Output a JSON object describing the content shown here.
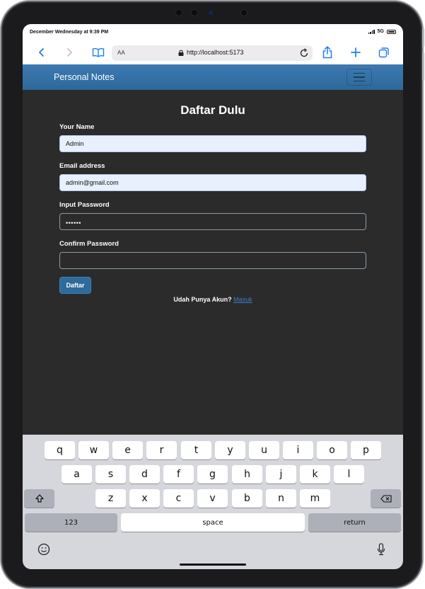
{
  "status": {
    "time": "December Wednesday at 9:39 PM",
    "network": "5G"
  },
  "browser": {
    "text_size_label": "AA",
    "url": "http://localhost:5173",
    "icons": [
      "chevron-left-icon",
      "chevron-right-icon",
      "book-icon",
      "lock-icon",
      "reload-icon",
      "share-icon",
      "plus-icon",
      "tabs-icon"
    ]
  },
  "navbar": {
    "brand": "Personal Notes"
  },
  "form": {
    "title": "Daftar Dulu",
    "name_label": "Your Name",
    "name_value": "Admin",
    "email_label": "Email address",
    "email_value": "admin@gmail.com",
    "password_label": "Input Password",
    "password_value": "••••••",
    "confirm_label": "Confirm Password",
    "confirm_value": "",
    "submit_label": "Daftar",
    "login_prompt": "Udah Punya Akun?",
    "login_link": "Masuk"
  },
  "keyboard": {
    "row1": [
      "q",
      "w",
      "e",
      "r",
      "t",
      "y",
      "u",
      "i",
      "o",
      "p"
    ],
    "row2": [
      "a",
      "s",
      "d",
      "f",
      "g",
      "h",
      "j",
      "k",
      "l"
    ],
    "row3": [
      "z",
      "x",
      "c",
      "v",
      "b",
      "n",
      "m"
    ],
    "numbers_key": "123",
    "space_key": "space",
    "return_key": "return"
  },
  "colors": {
    "navbar": "#3d7ab3",
    "page_background": "#2b2b2b",
    "accent": "#1b7cf4",
    "submit_button": "#2e6a9a"
  }
}
